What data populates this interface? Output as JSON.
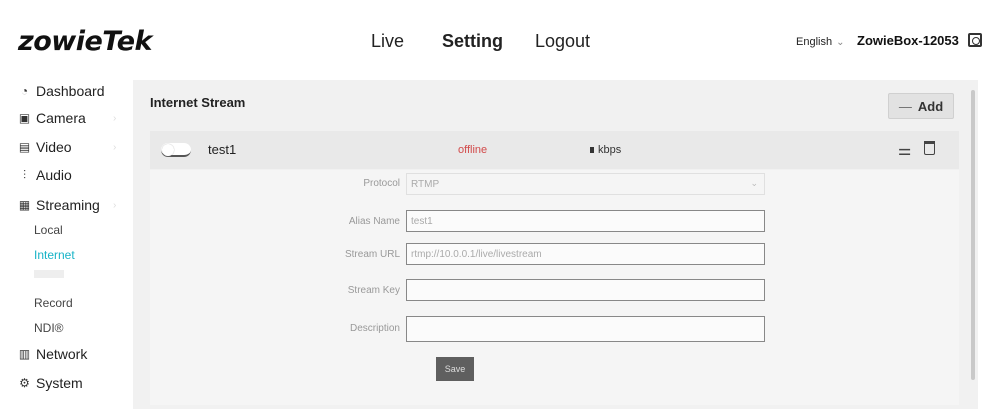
{
  "header": {
    "logo": "zowieTek",
    "nav": [
      "Live",
      "Setting",
      "Logout"
    ],
    "language": "English",
    "device": "ZowieBox-12053"
  },
  "sidebar": {
    "items": [
      {
        "label": "Dashboard",
        "icon": "dashboard-icon"
      },
      {
        "label": "Camera",
        "icon": "camera-icon"
      },
      {
        "label": "Video",
        "icon": "video-icon"
      },
      {
        "label": "Audio",
        "icon": "audio-icon"
      },
      {
        "label": "Streaming",
        "icon": "streaming-icon"
      }
    ],
    "sub_items": [
      "Local",
      "Internet",
      "Record",
      "NDI®"
    ],
    "after_items": [
      {
        "label": "Network",
        "icon": "network-icon"
      },
      {
        "label": "System",
        "icon": "system-icon"
      }
    ]
  },
  "main": {
    "section_title": "Internet Stream",
    "add_label": "Add",
    "stream": {
      "name": "test1",
      "status": "offline",
      "bitrate": "kbps"
    },
    "form": {
      "protocol_label": "Protocol",
      "protocol_value": "RTMP",
      "alias_label": "Alias Name",
      "alias_value": "test1",
      "url_label": "Stream URL",
      "url_value": "rtmp://10.0.0.1/live/livestream",
      "key_label": "Stream Key",
      "key_value": "",
      "desc_label": "Description",
      "desc_value": "",
      "save_label": "Save"
    }
  },
  "colors": {
    "accent": "#17b3c7",
    "offline": "#d24a4a",
    "panel": "#f1f1f1"
  }
}
